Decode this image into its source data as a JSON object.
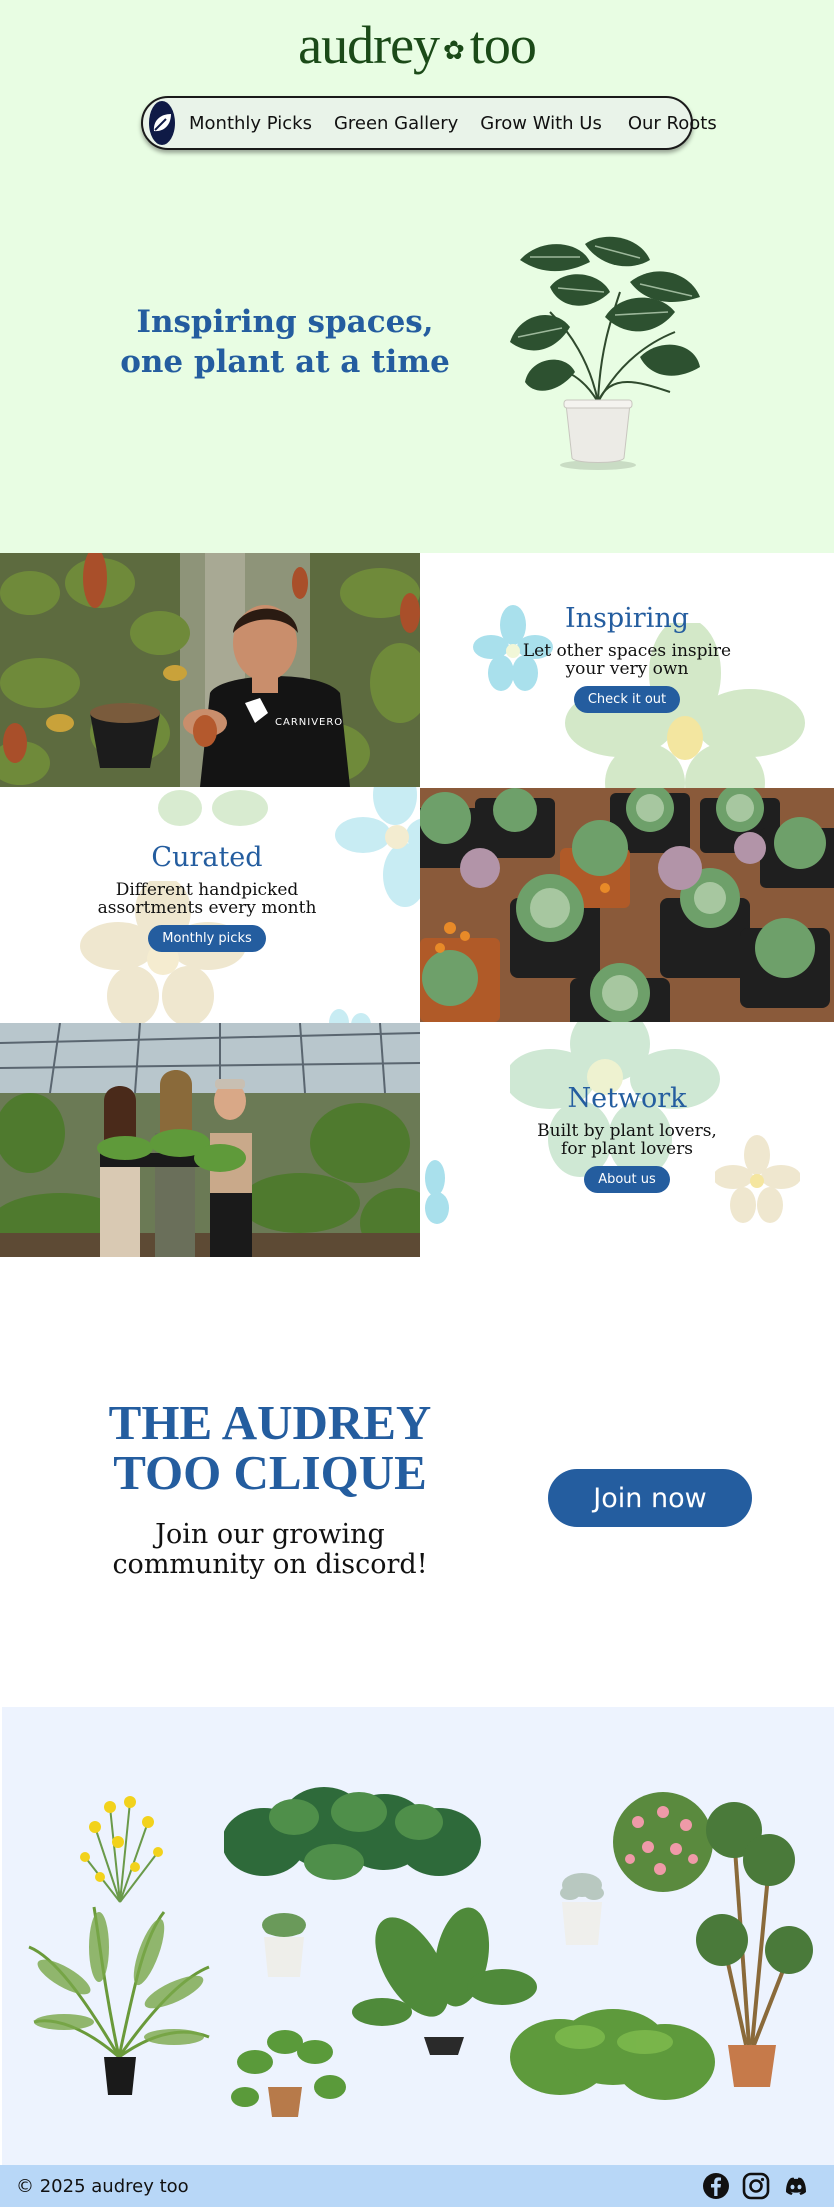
{
  "header": {
    "logo_left": "audrey",
    "logo_right": "too",
    "logo_glyph": "✿"
  },
  "nav": {
    "logo_icon": "leaf-icon",
    "links": [
      "Monthly Picks",
      "Green Gallery",
      "Grow With Us",
      "Our Roots"
    ]
  },
  "hero": {
    "title_line1": "Inspiring spaces,",
    "title_line2": "one plant at a time"
  },
  "features": [
    {
      "title": "Inspiring",
      "line1": "Let other spaces inspire",
      "line2": "your very own",
      "button": "Check it out"
    },
    {
      "title": "Curated",
      "line1": "Different handpicked",
      "line2": "assortments every month",
      "button": "Monthly picks"
    },
    {
      "title": "Network",
      "line1": "Built by plant lovers,",
      "line2": "for plant lovers",
      "button": "About us"
    }
  ],
  "photos": {
    "photo1_shirt": "CARNIVERO"
  },
  "clique": {
    "title_line1": "THE AUDREY",
    "title_line2": "TOO CLIQUE",
    "sub_line1": "Join our growing",
    "sub_line2": "community on discord!",
    "button": "Join now"
  },
  "footer": {
    "copyright": "© 2025  audrey  too",
    "socials": [
      "facebook-icon",
      "instagram-icon",
      "discord-icon"
    ]
  },
  "colors": {
    "hero_bg": "#e8fde3",
    "accent": "#245d9f",
    "gallery_bg": "#edf3fe",
    "footer_bg": "#b8d7f7",
    "logo_green": "#1b4a18"
  }
}
